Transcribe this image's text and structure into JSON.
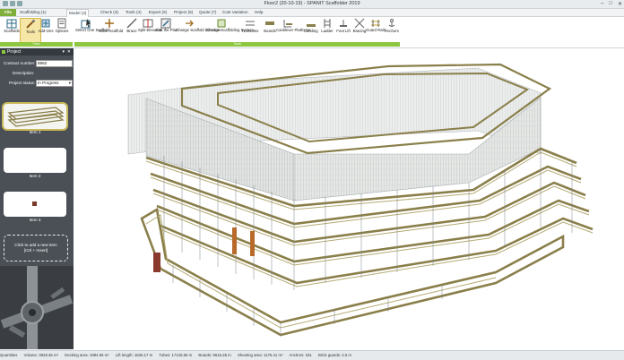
{
  "window": {
    "title": "Floor2 (20-10-19) - SPANIT Scaffolder 2019"
  },
  "tabs": [
    "File",
    "Scaffolding (1)",
    "Model (2)",
    "Check (3)",
    "Tools (4)",
    "Export (5)",
    "Project (6)",
    "Quote (7)",
    "Cost Variation",
    "Help"
  ],
  "active_tab": "Model (2)",
  "ribbon": {
    "buttons": [
      "Scaffolds",
      "Tools",
      "Add-Ons",
      "Options",
      "Select One Scaffold",
      "Move Scaffold",
      "Brace",
      "Split Elevation",
      "Edit the Plan",
      "Change Scaffold Direction",
      "Change Scaffolding System",
      "Transoms",
      "Boards",
      "Cantilever Platforms",
      "Landing",
      "Ladder",
      "Foot Lift",
      "Bracing",
      "Guard Rails",
      "Anchors"
    ],
    "groups": [
      "View",
      "Tools"
    ]
  },
  "project_panel": {
    "title": "Project",
    "contract_label": "Contract number:",
    "contract_value": "8962",
    "description_label": "Description:",
    "status_label": "Project status:",
    "status_value": "In Progress",
    "items": [
      "Item 1",
      "Item 2",
      "Item 3"
    ],
    "add_item_line1": "Click to add a new item",
    "add_item_line2": "[Ctrl + Insert]"
  },
  "status_bar": [
    "Quantities",
    "Volume: 3928.36 m³",
    "Decking area: 1894.96 m²",
    "Lift length: 1826.17 m",
    "Tubes: 17126.66 m",
    "Boards: 9616.35 m",
    "Sheeting area: 1175.41 m²",
    "Anchors: 331",
    "Brick guards: 2.5 m"
  ],
  "colors": {
    "accent": "#8dc63f",
    "panel": "#4a5056",
    "deck": "#8a7f4a"
  }
}
